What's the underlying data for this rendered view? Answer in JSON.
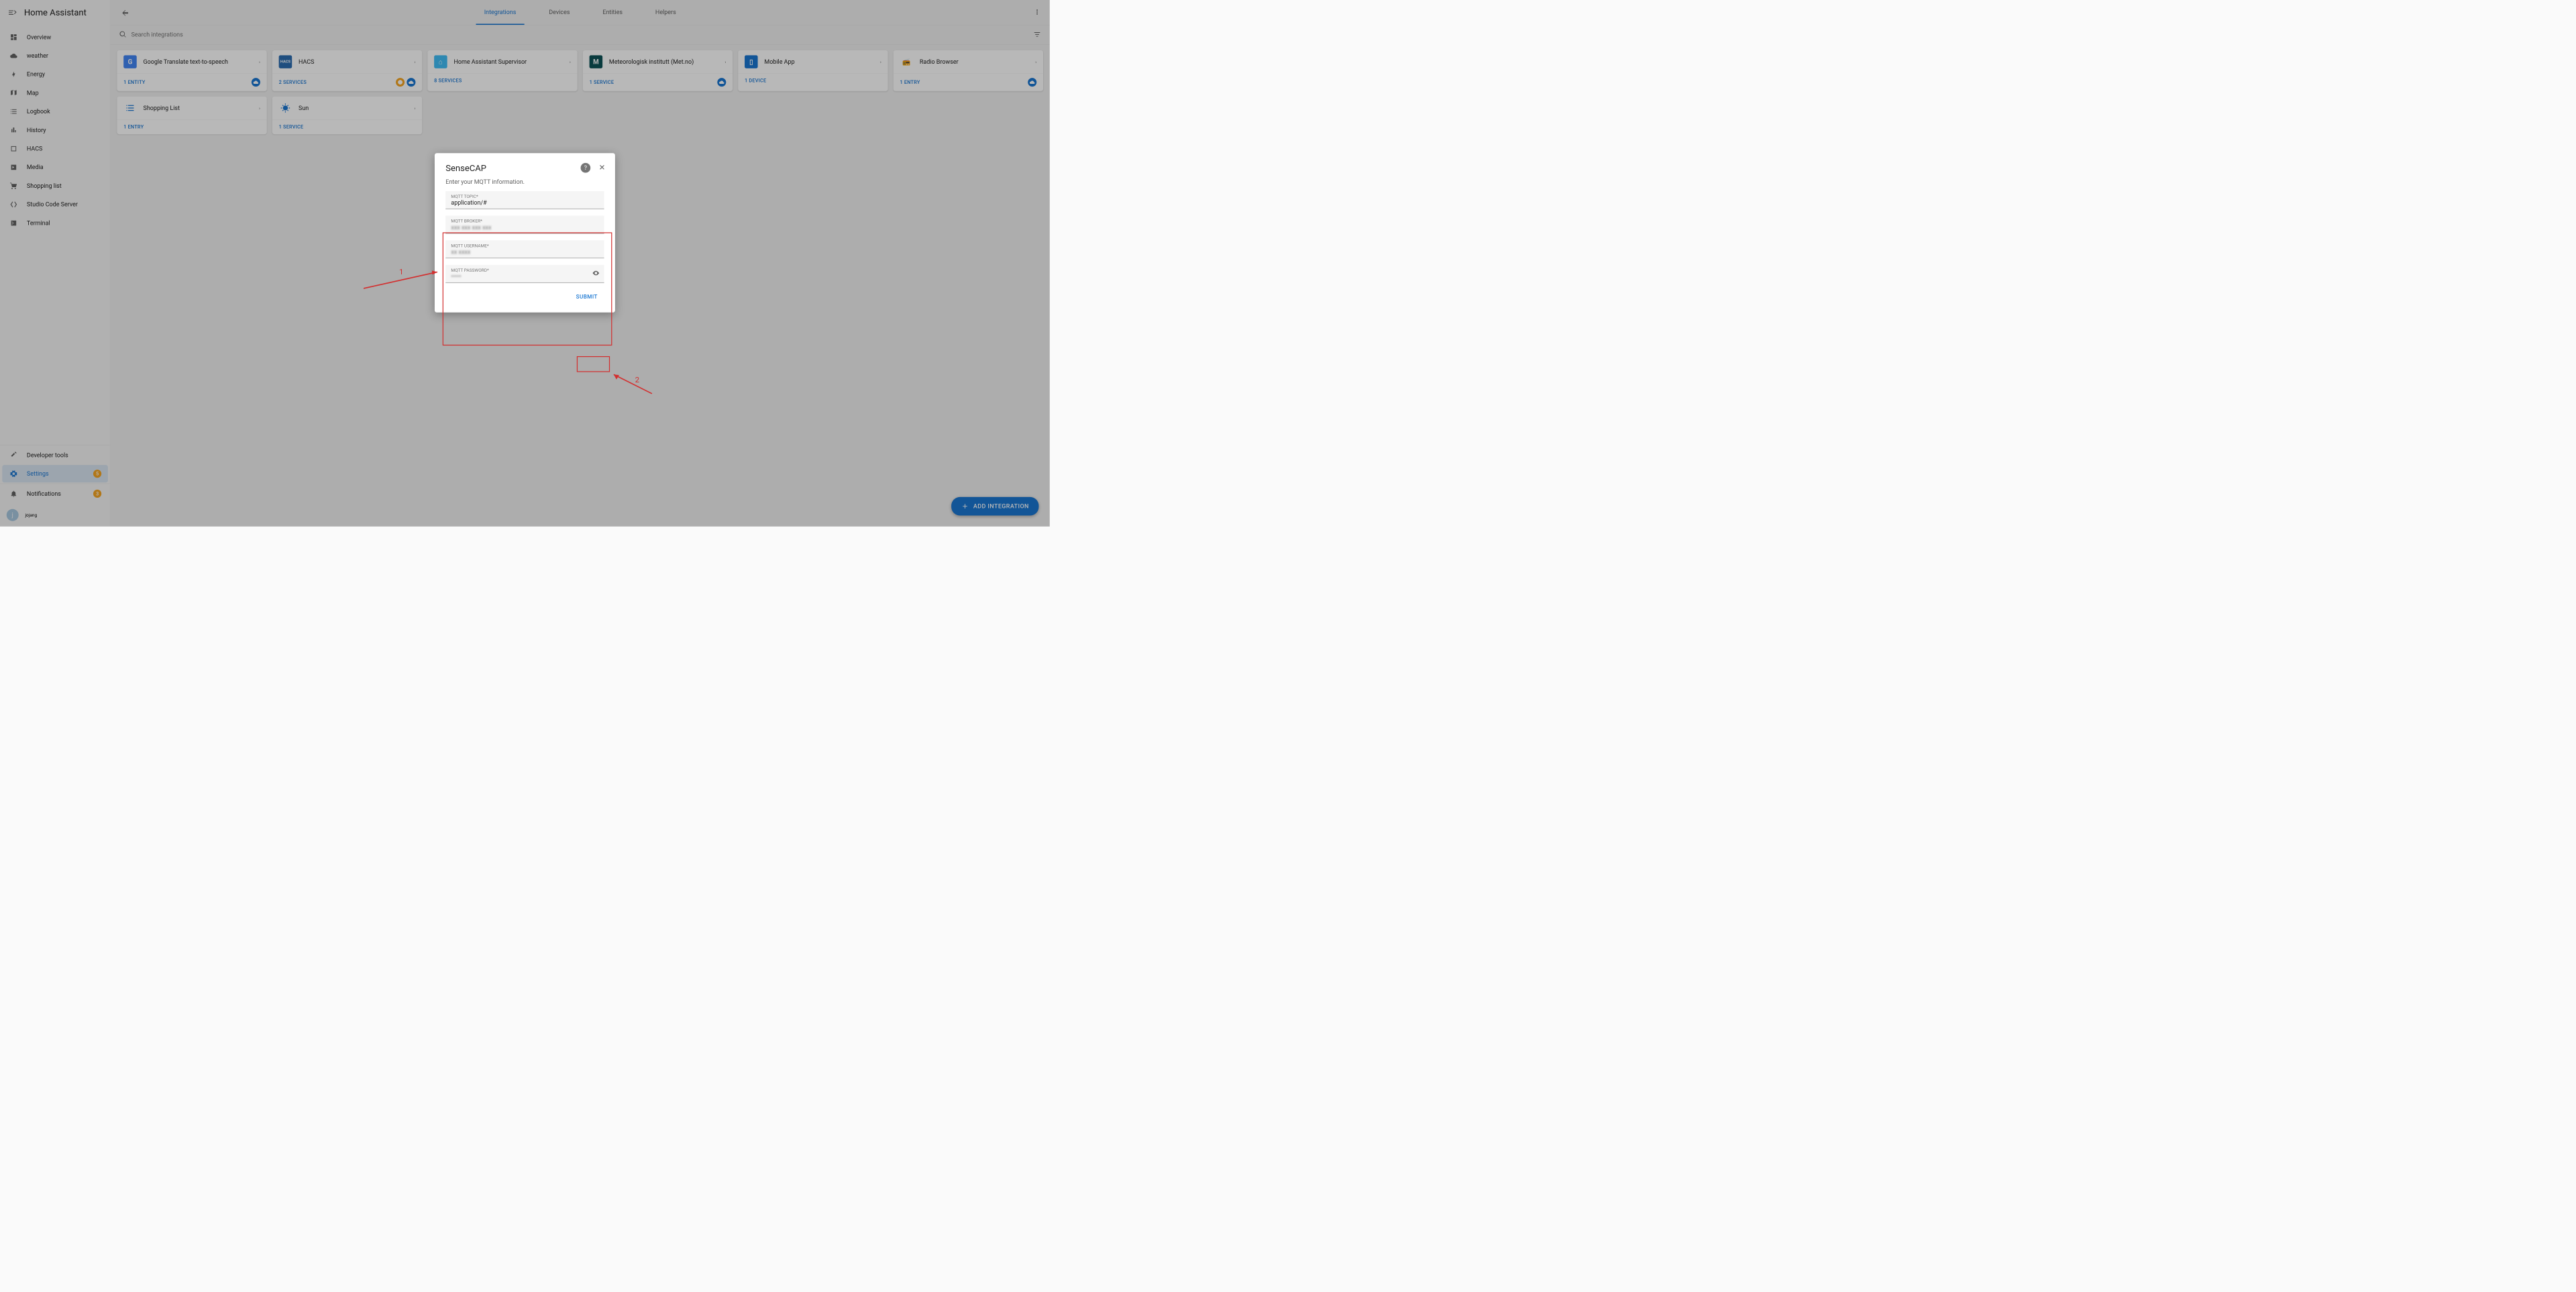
{
  "sidebar": {
    "title": "Home Assistant",
    "items": [
      {
        "label": "Overview",
        "icon": "dashboard"
      },
      {
        "label": "weather",
        "icon": "cloud"
      },
      {
        "label": "Energy",
        "icon": "bolt"
      },
      {
        "label": "Map",
        "icon": "map"
      },
      {
        "label": "Logbook",
        "icon": "list"
      },
      {
        "label": "History",
        "icon": "chart"
      },
      {
        "label": "HACS",
        "icon": "hacs"
      },
      {
        "label": "Media",
        "icon": "media"
      },
      {
        "label": "Shopping list",
        "icon": "cart"
      },
      {
        "label": "Studio Code Server",
        "icon": "code"
      },
      {
        "label": "Terminal",
        "icon": "terminal"
      }
    ],
    "footer_items": [
      {
        "label": "Developer tools",
        "icon": "hammer"
      },
      {
        "label": "Settings",
        "icon": "gear",
        "active": true,
        "badge": "5"
      },
      {
        "label": "Notifications",
        "icon": "bell",
        "badge": "3"
      }
    ],
    "user": {
      "initial": "j",
      "name": "jojang"
    }
  },
  "tabs": [
    {
      "label": "Integrations",
      "active": true
    },
    {
      "label": "Devices"
    },
    {
      "label": "Entities"
    },
    {
      "label": "Helpers"
    }
  ],
  "search_placeholder": "Search integrations",
  "integrations": [
    {
      "title": "Google Translate text-to-speech",
      "footer": "1 ENTITY",
      "icon": "google",
      "cloud": true
    },
    {
      "title": "HACS",
      "footer": "2 SERVICES",
      "icon": "hacs",
      "cloud": true,
      "orange": true
    },
    {
      "title": "Home Assistant Supervisor",
      "footer": "8 SERVICES",
      "icon": "ha"
    },
    {
      "title": "Meteorologisk institutt (Met.no)",
      "footer": "1 SERVICE",
      "icon": "met",
      "cloud": true
    },
    {
      "title": "Mobile App",
      "footer": "1 DEVICE",
      "icon": "mobile"
    },
    {
      "title": "Radio Browser",
      "footer": "1 ENTRY",
      "icon": "radio",
      "cloud": true
    },
    {
      "title": "Shopping List",
      "footer": "1 ENTRY",
      "icon": "shopping"
    },
    {
      "title": "Sun",
      "footer": "1 SERVICE",
      "icon": "sun"
    }
  ],
  "fab_label": "ADD INTEGRATION",
  "dialog": {
    "title": "SenseCAP",
    "subtitle": "Enter your MQTT information.",
    "fields": [
      {
        "label": "MQTT TOPIC*",
        "value": "application/#"
      },
      {
        "label": "MQTT BROKER*",
        "value": ""
      },
      {
        "label": "MQTT USERNAME*",
        "value": ""
      },
      {
        "label": "MQTT PASSWORD*",
        "value": "",
        "password": true
      }
    ],
    "submit": "SUBMIT"
  },
  "annotations": {
    "label1": "1",
    "label2": "2"
  }
}
